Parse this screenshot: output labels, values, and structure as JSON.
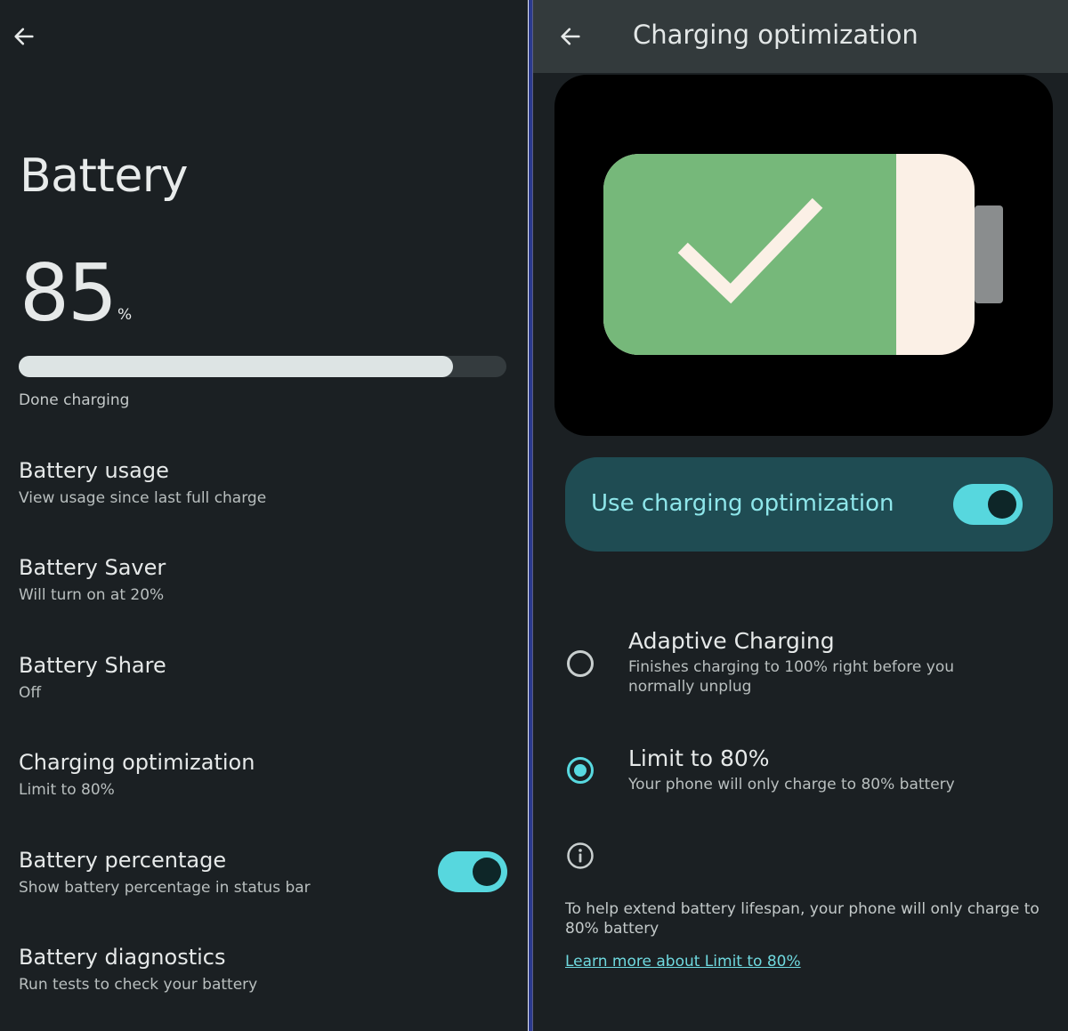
{
  "battery_screen": {
    "title": "Battery",
    "level_percent": "85",
    "percent_sign": "%",
    "level_fraction": 0.89,
    "status": "Done charging",
    "settings": [
      {
        "title": "Battery usage",
        "subtitle": "View usage since last full charge"
      },
      {
        "title": "Battery Saver",
        "subtitle": "Will turn on at 20%"
      },
      {
        "title": "Battery Share",
        "subtitle": "Off"
      },
      {
        "title": "Charging optimization",
        "subtitle": "Limit to 80%"
      },
      {
        "title": "Battery percentage",
        "subtitle": "Show battery percentage in status bar",
        "toggle_on": true
      },
      {
        "title": "Battery diagnostics",
        "subtitle": "Run tests to check your battery"
      }
    ]
  },
  "charging_screen": {
    "title": "Charging optimization",
    "use_optimization_label": "Use charging optimization",
    "use_optimization_on": true,
    "options": [
      {
        "title": "Adaptive Charging",
        "subtitle": "Finishes charging to 100% right before you normally unplug",
        "selected": false
      },
      {
        "title": "Limit to 80%",
        "subtitle": "Your phone will only charge to 80% battery",
        "selected": true
      }
    ],
    "info_text": "To help extend battery lifespan, your phone will only charge to 80% battery",
    "learn_more_link": "Learn more about Limit to 80%"
  },
  "colors": {
    "background": "#1b2023",
    "accent": "#57d7de",
    "battery_green": "#76b87a",
    "battery_cream": "#fbf0e6"
  },
  "icons": [
    "arrow-back-icon",
    "battery-check-icon",
    "info-icon"
  ]
}
